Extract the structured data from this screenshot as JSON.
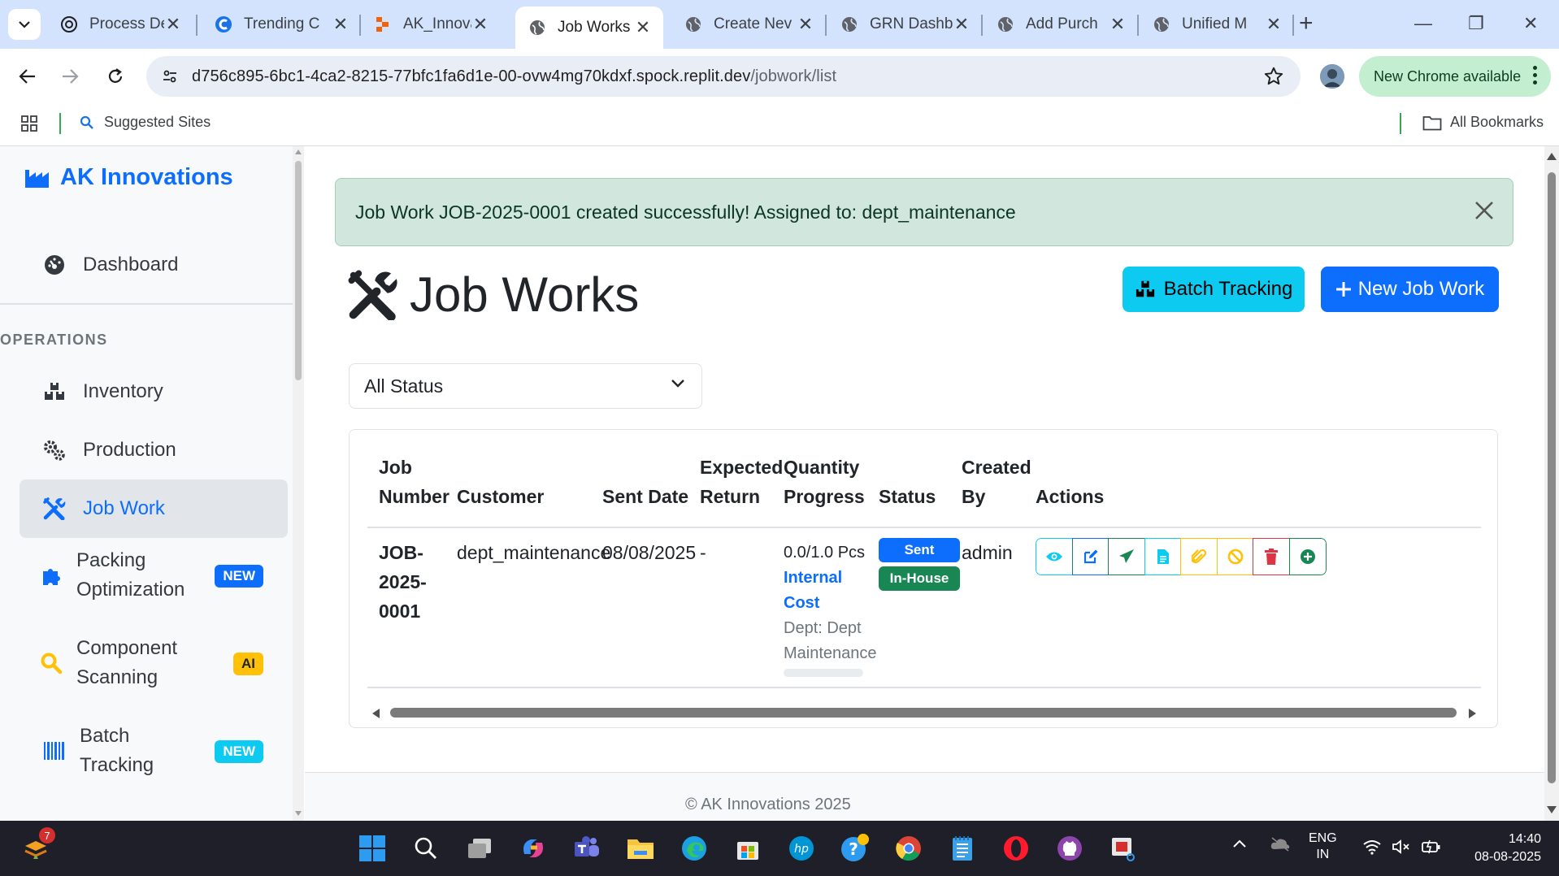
{
  "browser": {
    "tabs": [
      {
        "title": "Process De"
      },
      {
        "title": "Trending C"
      },
      {
        "title": "AK_Innova"
      },
      {
        "title": "Job Works"
      },
      {
        "title": "Create Nev"
      },
      {
        "title": "GRN Dashb"
      },
      {
        "title": "Add Purch"
      },
      {
        "title": "Unified M"
      }
    ],
    "url_domain": "d756c895-6bc1-4ca2-8215-77bfc1fa6d1e-00-ovw4mg70kdxf.spock.replit.dev",
    "url_path": "/jobwork/list",
    "new_chrome": "New Chrome available",
    "bookmark_suggested": "Suggested Sites",
    "bookmark_all": "All Bookmarks"
  },
  "sidebar": {
    "brand": "AK Innovations",
    "dashboard": "Dashboard",
    "section": "OPERATIONS",
    "items": [
      {
        "label": "Inventory"
      },
      {
        "label": "Production"
      },
      {
        "label": "Job Work"
      },
      {
        "label1": "Packing",
        "label2": "Optimization",
        "badge": "NEW"
      },
      {
        "label1": "Component",
        "label2": "Scanning",
        "badge": "AI"
      },
      {
        "label1": "Batch",
        "label2": "Tracking",
        "badge": "NEW"
      }
    ]
  },
  "main": {
    "alert": "Job Work JOB-2025-0001 created successfully! Assigned to: dept_maintenance",
    "title": "Job Works",
    "btn_batch": "Batch Tracking",
    "btn_new": "New Job Work",
    "filter_value": "All Status",
    "headers": {
      "job1": "Job",
      "job2": "Number",
      "customer": "Customer",
      "sent": "Sent Date",
      "exp1": "Expected",
      "exp2": "Return",
      "qty1": "Quantity",
      "qty2": "Progress",
      "status": "Status",
      "cb1": "Created",
      "cb2": "By",
      "actions": "Actions"
    },
    "row": {
      "job1": "JOB-",
      "job2": "2025-",
      "job3": "0001",
      "customer": "dept_maintenance",
      "sent_date": "08/08/2025",
      "expected": "-",
      "qty": "0.0/1.0 Pcs",
      "cost1": "Internal",
      "cost2": "Cost",
      "dept1": "Dept: Dept",
      "dept2": "Maintenance",
      "progress": 0,
      "status_sent": "Sent",
      "status_inhouse": "In-House",
      "created_by": "admin"
    },
    "footer": "© AK Innovations 2025"
  },
  "taskbar": {
    "notif_count": "7",
    "lang1": "ENG",
    "lang2": "IN",
    "time": "14:40",
    "date": "08-08-2025"
  },
  "colors": {
    "primary": "#0d6efd",
    "info": "#0dcaf0",
    "success": "#198754",
    "warning": "#ffc107",
    "danger": "#dc3545"
  }
}
